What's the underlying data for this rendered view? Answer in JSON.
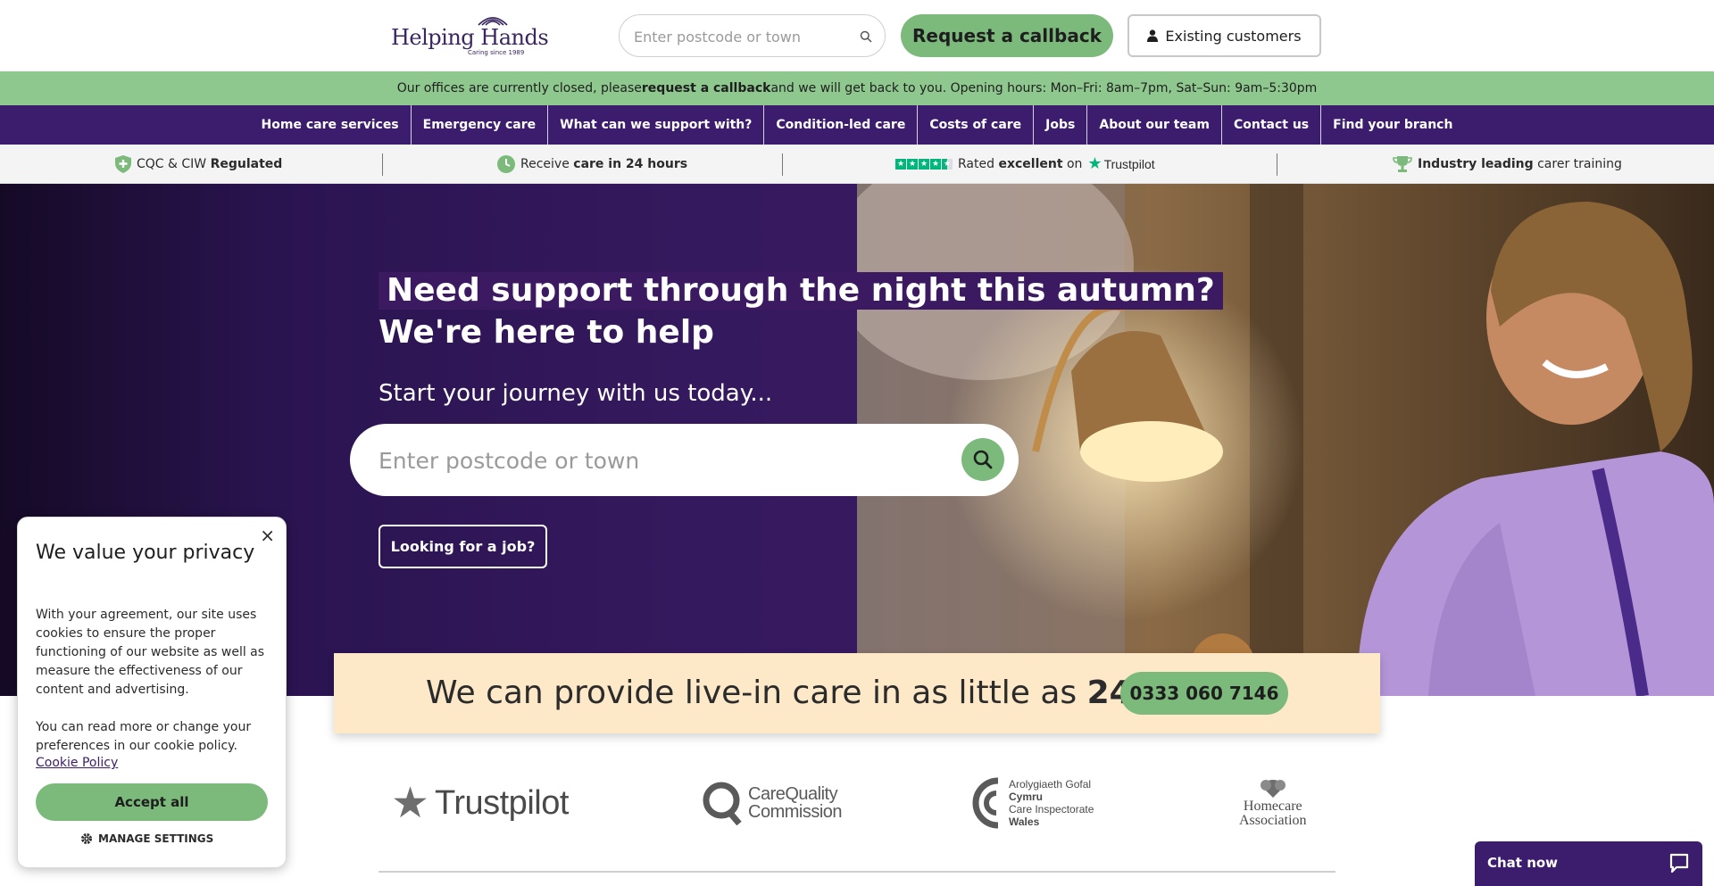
{
  "header": {
    "logo_name": "Helping Hands",
    "logo_tagline": "Caring since 1989",
    "search_placeholder": "Enter postcode or town",
    "callback_label": "Request a callback",
    "existing_label": "Existing customers"
  },
  "notice": {
    "before": "Our offices are currently closed, please ",
    "bold": "request a callback",
    "after": " and we will get back to you. Opening hours: Mon–Fri: 8am–7pm, Sat–Sun: 9am–5:30pm"
  },
  "nav": {
    "items": [
      {
        "label": "Home care services"
      },
      {
        "label": "Emergency care"
      },
      {
        "label": "What can we support with?"
      },
      {
        "label": "Condition-led care"
      },
      {
        "label": "Costs of care"
      },
      {
        "label": "Jobs"
      },
      {
        "label": "About our team"
      },
      {
        "label": "Contact us"
      },
      {
        "label": "Find your branch"
      }
    ]
  },
  "trust": {
    "cqc_pre": "CQC & CIW ",
    "cqc_bold": "Regulated",
    "care_pre": "Receive ",
    "care_bold": "care in 24 hours",
    "rated_pre": "Rated ",
    "rated_bold": "excellent",
    "rated_on": " on",
    "trustpilot": "Trustpilot",
    "training_bold": "Industry leading",
    "training_post": " carer training"
  },
  "hero": {
    "headline_1": "Need support through the night this autumn?",
    "headline_2": "We're here to help",
    "subtitle": "Start your journey with us today...",
    "search_placeholder": "Enter postcode or town",
    "job_button": "Looking for a job?"
  },
  "promo": {
    "text_pre": "We can provide live-in care in as little as ",
    "text_bold": "24 hours!",
    "phone": "0333 060 7146"
  },
  "accreditations": {
    "trustpilot": "Trustpilot",
    "cqc_line1": "CareQuality",
    "cqc_line2": "Commission",
    "ciw_line1": "Arolygiaeth Gofal",
    "ciw_line2": "Cymru",
    "ciw_line3": "Care Inspectorate",
    "ciw_line4": "Wales",
    "hca_line1": "Homecare",
    "hca_line2": "Association"
  },
  "cookie": {
    "title": "We value your privacy",
    "p1": "With your agreement, our site uses cookies to ensure the proper functioning of our website as well as measure the effectiveness of our content and advertising.",
    "p2": "You can read more or change your preferences in our cookie policy.",
    "link": "Cookie Policy",
    "accept": "Accept all",
    "manage": "MANAGE SETTINGS",
    "close": "×"
  },
  "chat": {
    "label": "Chat now"
  },
  "colors": {
    "brand_purple": "#3c1c6c",
    "accent_green": "#7cba7c",
    "notice_green": "#8fc88f",
    "promo_cream": "#fde8c8",
    "trustpilot_green": "#00b67a"
  }
}
